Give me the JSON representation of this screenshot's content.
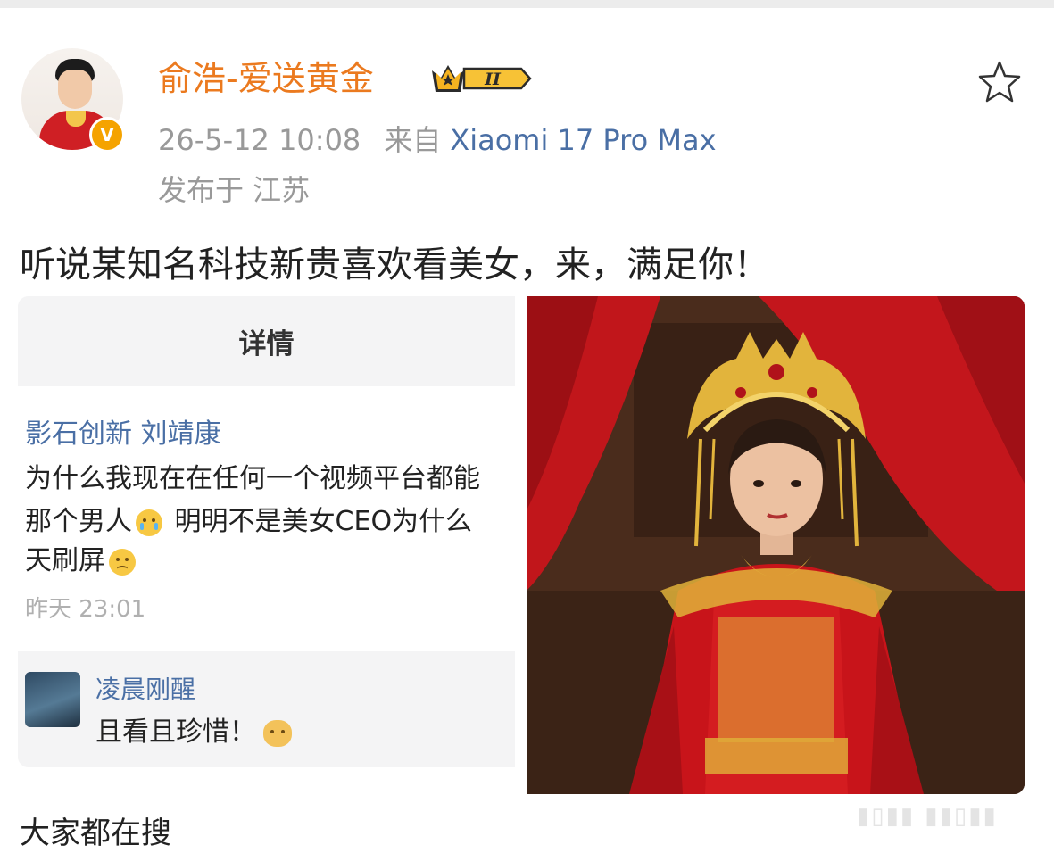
{
  "post": {
    "username": "俞浩-爱送黄金",
    "level_badge": "II",
    "timestamp": "26-5-12 10:08",
    "from_label": "来自",
    "device": "Xiaomi 17 Pro Max",
    "location": "发布于 江苏",
    "text": "听说某知名科技新贵喜欢看美女，来，满足你！"
  },
  "screenshot": {
    "header": "详情",
    "comment_author": "影石创新 刘靖康",
    "comment_line1": "为什么我现在在任何一个视频平台都能",
    "comment_line2a": "那个男人",
    "comment_line2b": "明明不是美女CEO为什么",
    "comment_line3": "天刷屏",
    "comment_time": "昨天 23:01",
    "reply_name": "凌晨刚醒",
    "reply_text": "且看且珍惜！"
  },
  "footer": {
    "search_heading": "大家都在搜"
  },
  "colors": {
    "username": "#eb7a1f",
    "link": "#4a6fa5",
    "meta": "#999999",
    "verified_badge": "#f5a300",
    "dress_red": "#c8141a",
    "gold": "#e0b23a"
  },
  "icons": {
    "favorite": "star-outline-icon",
    "verified": "verified-v-icon",
    "level": "crown-level-icon"
  }
}
